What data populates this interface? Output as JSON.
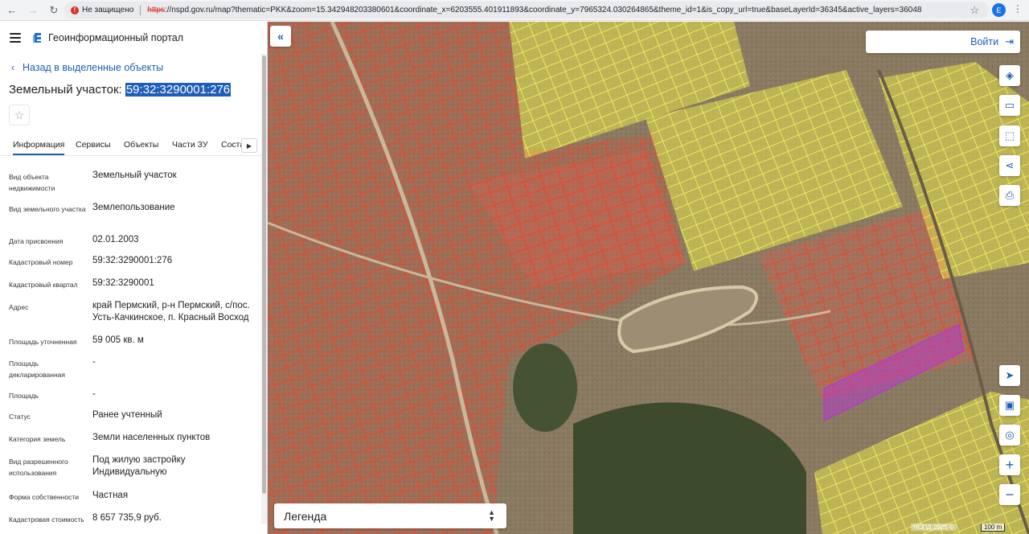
{
  "browser": {
    "security_label": "Не защищено",
    "url_scheme": "https",
    "url_rest": "://nspd.gov.ru/map?thematic=PKK&zoom=15.342948203380601&coordinate_x=6203555.401911893&coordinate_y=7965324.030264865&theme_id=1&is_copy_url=true&baseLayerId=36345&active_layers=36048",
    "profile_initial": "E"
  },
  "sidebar": {
    "portal_title": "Геоинформационный портал",
    "back_link": "Назад в выделенные объекты",
    "object_title_prefix": "Земельный участок: ",
    "object_title_number": "59:32:3290001:276",
    "tabs": [
      {
        "label": "Информация",
        "active": true
      },
      {
        "label": "Сервисы"
      },
      {
        "label": "Объекты"
      },
      {
        "label": "Части ЗУ"
      },
      {
        "label": "Соста"
      }
    ],
    "properties": [
      {
        "key": "Вид объекта недвижимости",
        "value": "Земельный участок"
      },
      {
        "key": "Вид земельного участка",
        "value": "Землепользование"
      },
      {
        "key": "Дата присвоения",
        "value": "02.01.2003"
      },
      {
        "key": "Кадастровый номер",
        "value": "59:32:3290001:276"
      },
      {
        "key": "Кадастровый квартал",
        "value": "59:32:3290001"
      },
      {
        "key": "Адрес",
        "value": "край Пермский, р-н Пермский, с/пос. Усть-Качкинское, п. Красный Восход"
      },
      {
        "key": "Площадь уточненная",
        "value": "59 005 кв. м"
      },
      {
        "key": "Площадь декларированная",
        "value": "-"
      },
      {
        "key": "Площадь",
        "value": "-"
      },
      {
        "key": "Статус",
        "value": "Ранее учтенный"
      },
      {
        "key": "Категория земель",
        "value": "Земли населенных пунктов"
      },
      {
        "key": "Вид разрешенного использования",
        "value": "Под жилую застройку Индивидуальную"
      },
      {
        "key": "Форма собственности",
        "value": "Частная"
      },
      {
        "key": "Кадастровая стоимость",
        "value": "8 657 735,9 руб."
      }
    ]
  },
  "map": {
    "login_label": "Войти",
    "legend_label": "Легенда",
    "attribution": "НСПД 2025 ©",
    "scale_label": "100 m",
    "colors": {
      "parcel_outline": "#e8472f",
      "zone_yellow": "#e6e34a",
      "selected_parcel": "#b43cc8"
    },
    "tools": [
      "layers-icon",
      "ruler-icon",
      "select-area-icon",
      "share-icon",
      "print-icon",
      "locate-icon",
      "minimap-icon",
      "geo-search-icon",
      "zoom-in-icon",
      "zoom-out-icon"
    ]
  }
}
